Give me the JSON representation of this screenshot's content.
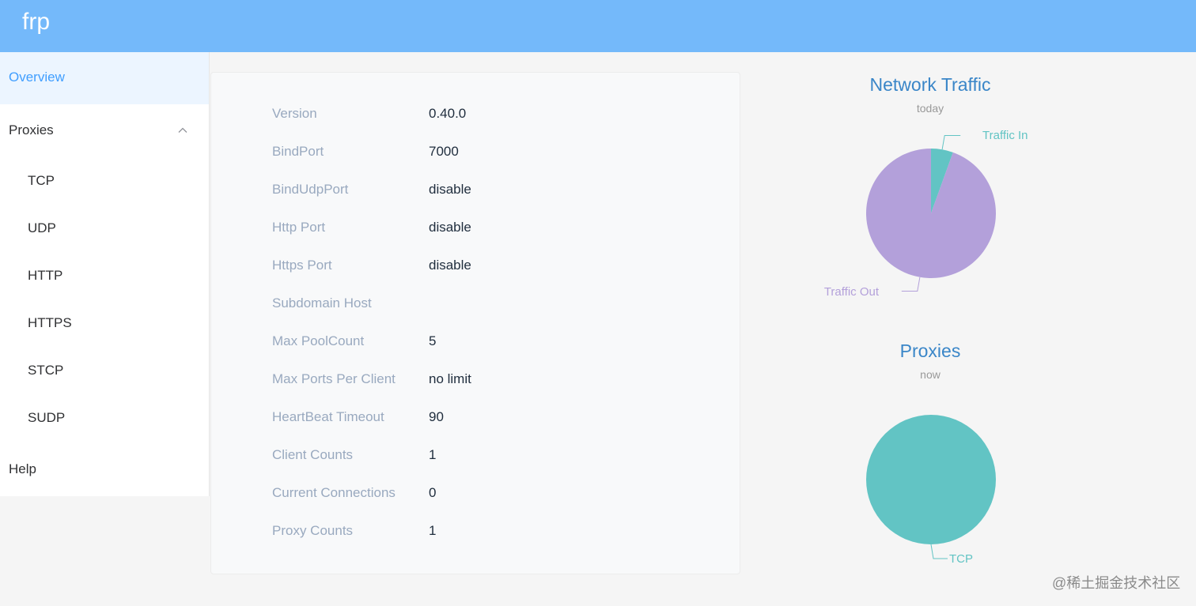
{
  "app": {
    "brand": "frp"
  },
  "sidebar": {
    "overview": "Overview",
    "proxies": "Proxies",
    "proxy_types": [
      "TCP",
      "UDP",
      "HTTP",
      "HTTPS",
      "STCP",
      "SUDP"
    ],
    "help": "Help"
  },
  "server_info": [
    {
      "key": "Version",
      "value": "0.40.0"
    },
    {
      "key": "BindPort",
      "value": "7000"
    },
    {
      "key": "BindUdpPort",
      "value": "disable"
    },
    {
      "key": "Http Port",
      "value": "disable"
    },
    {
      "key": "Https Port",
      "value": "disable"
    },
    {
      "key": "Subdomain Host",
      "value": ""
    },
    {
      "key": "Max PoolCount",
      "value": "5"
    },
    {
      "key": "Max Ports Per Client",
      "value": "no limit"
    },
    {
      "key": "HeartBeat Timeout",
      "value": "90"
    },
    {
      "key": "Client Counts",
      "value": "1"
    },
    {
      "key": "Current Connections",
      "value": "0"
    },
    {
      "key": "Proxy Counts",
      "value": "1"
    }
  ],
  "chart_data": [
    {
      "type": "pie",
      "title": "Network Traffic",
      "subtitle": "today",
      "slices": [
        {
          "label": "Traffic In",
          "value": 5.5,
          "color": "#62c4c4"
        },
        {
          "label": "Traffic Out",
          "value": 94.5,
          "color": "#b3a0da"
        }
      ]
    },
    {
      "type": "pie",
      "title": "Proxies",
      "subtitle": "now",
      "slices": [
        {
          "label": "TCP",
          "value": 100,
          "color": "#62c4c4"
        }
      ]
    }
  ],
  "watermark": "@稀土掘金技术社区"
}
